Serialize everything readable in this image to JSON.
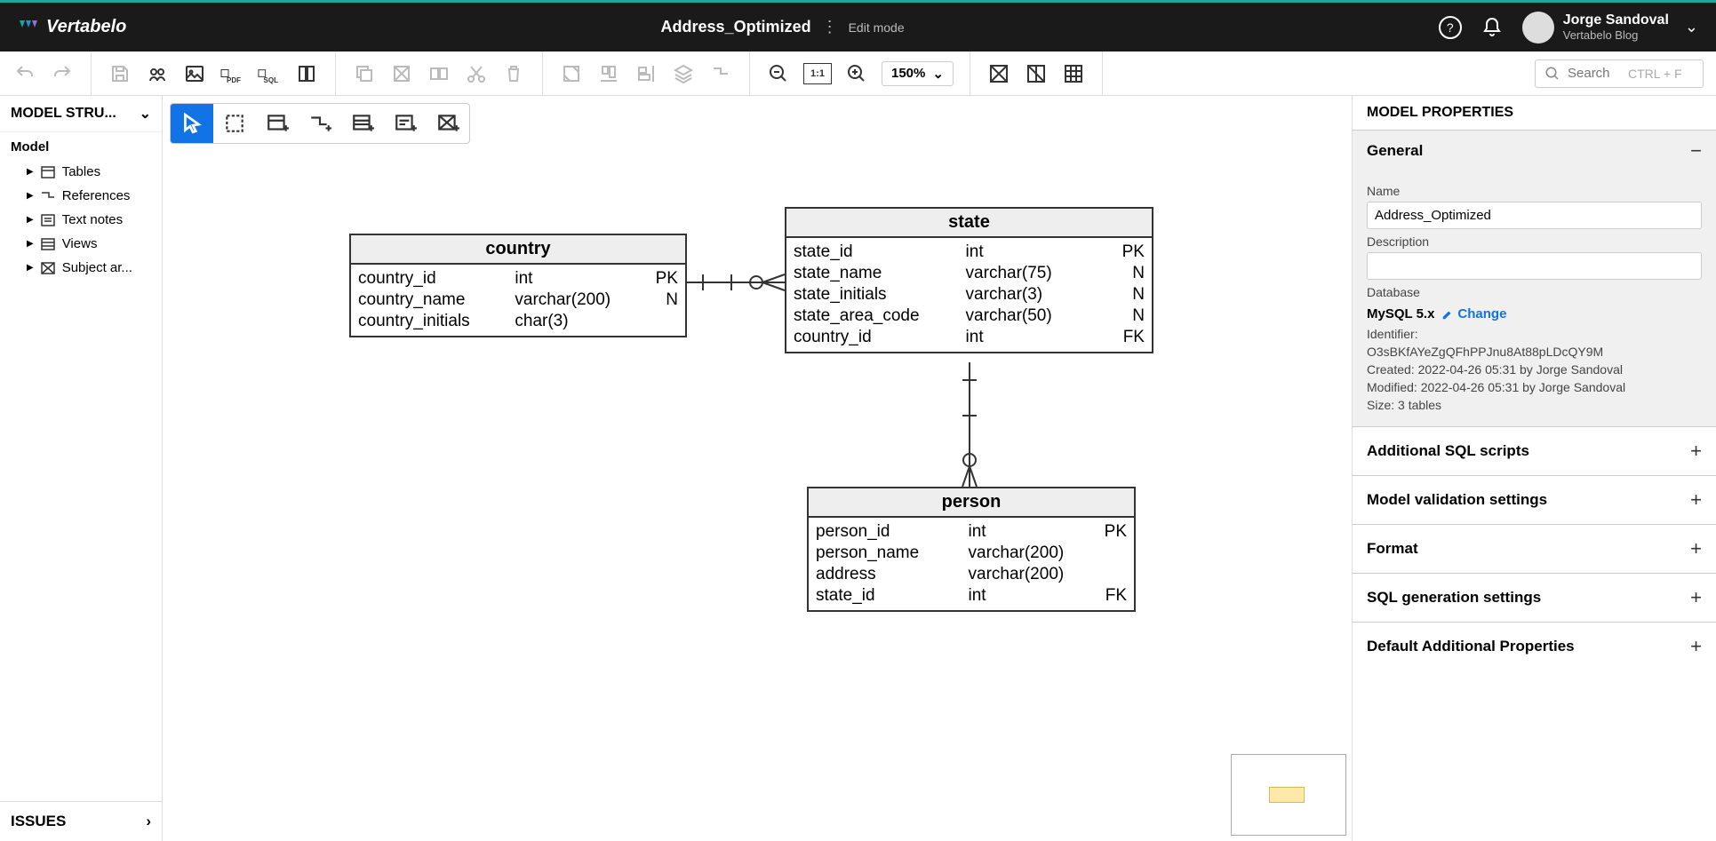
{
  "app": {
    "name": "Vertabelo"
  },
  "header": {
    "model_title": "Address_Optimized",
    "edit_mode": "Edit mode",
    "user_name": "Jorge Sandoval",
    "user_sub": "Vertabelo Blog"
  },
  "toolbar": {
    "zoom": "150%",
    "search_placeholder": "Search",
    "search_hint": "CTRL + F"
  },
  "left_panel": {
    "title": "MODEL STRU...",
    "root": "Model",
    "items": [
      "Tables",
      "References",
      "Text notes",
      "Views",
      "Subject ar..."
    ],
    "issues": "ISSUES"
  },
  "erd": {
    "tables": {
      "country": {
        "title": "country",
        "rows": [
          {
            "name": "country_id",
            "type": "int",
            "key": "PK"
          },
          {
            "name": "country_name",
            "type": "varchar(200)",
            "key": "N"
          },
          {
            "name": "country_initials",
            "type": "char(3)",
            "key": ""
          }
        ]
      },
      "state": {
        "title": "state",
        "rows": [
          {
            "name": "state_id",
            "type": "int",
            "key": "PK"
          },
          {
            "name": "state_name",
            "type": "varchar(75)",
            "key": "N"
          },
          {
            "name": "state_initials",
            "type": "varchar(3)",
            "key": "N"
          },
          {
            "name": "state_area_code",
            "type": "varchar(50)",
            "key": "N"
          },
          {
            "name": "country_id",
            "type": "int",
            "key": "FK"
          }
        ]
      },
      "person": {
        "title": "person",
        "rows": [
          {
            "name": "person_id",
            "type": "int",
            "key": "PK"
          },
          {
            "name": "person_name",
            "type": "varchar(200)",
            "key": ""
          },
          {
            "name": "address",
            "type": "varchar(200)",
            "key": ""
          },
          {
            "name": "state_id",
            "type": "int",
            "key": "FK"
          }
        ]
      }
    }
  },
  "right_panel": {
    "title": "MODEL PROPERTIES",
    "general": {
      "heading": "General",
      "name_label": "Name",
      "name_value": "Address_Optimized",
      "desc_label": "Description",
      "desc_value": "",
      "db_label": "Database",
      "db_value": "MySQL 5.x",
      "change": "Change",
      "identifier_label": "Identifier:",
      "identifier": "O3sBKfAYeZgQFhPPJnu8At88pLDcQY9M",
      "created": "Created: 2022-04-26 05:31 by Jorge Sandoval",
      "modified": "Modified: 2022-04-26 05:31 by Jorge Sandoval",
      "size": "Size: 3 tables"
    },
    "collapsed": [
      "Additional SQL scripts",
      "Model validation settings",
      "Format",
      "SQL generation settings",
      "Default Additional Properties"
    ]
  }
}
